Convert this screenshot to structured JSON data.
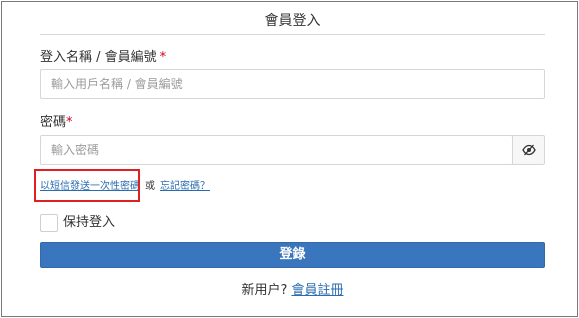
{
  "form": {
    "title": "會員登入",
    "username": {
      "label": "登入名稱 / 會員編號",
      "required_mark": "*",
      "placeholder": "輸入用戶名稱 / 會員編號",
      "value": ""
    },
    "password": {
      "label": "密碼",
      "required_mark": "*",
      "placeholder": "輸入密碼",
      "value": "",
      "toggle_icon": "eye-slash-icon"
    },
    "links": {
      "sms_otp": "以短信發送一次性密碼",
      "or": "或",
      "forgot_password": "忘記密碼？"
    },
    "remember_me": {
      "label": "保持登入",
      "checked": false
    },
    "submit_label": "登錄",
    "register": {
      "prompt": "新用户?",
      "link": "會員註冊"
    }
  },
  "colors": {
    "primary_button": "#3a76bd",
    "link": "#2a6cb0",
    "required": "#d0021b",
    "highlight_box": "#e02020"
  }
}
